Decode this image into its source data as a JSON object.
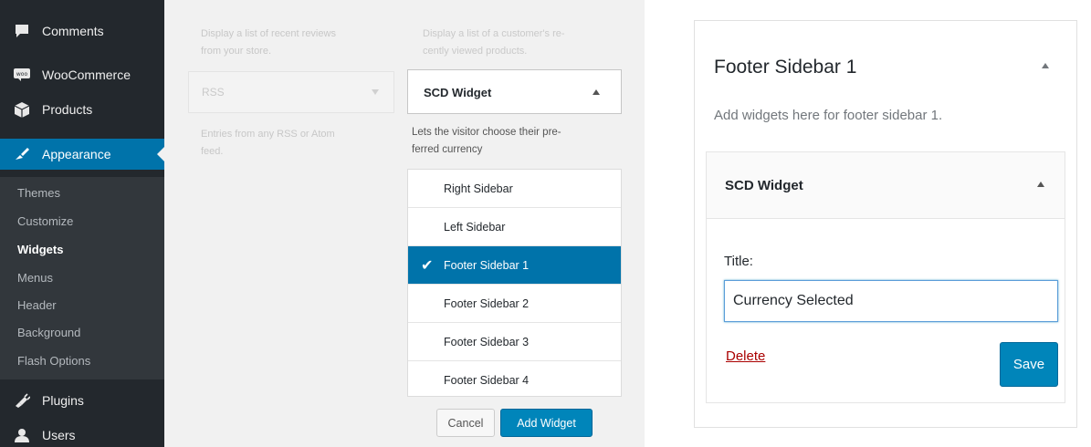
{
  "admin_menu": {
    "items": [
      {
        "label": "Comments",
        "icon": "comments-icon"
      },
      {
        "label": "WooCommerce",
        "icon": "woocommerce-icon"
      },
      {
        "label": "Products",
        "icon": "products-icon"
      },
      {
        "label": "Appearance",
        "icon": "appearance-icon",
        "active": true
      }
    ],
    "submenu": [
      "Themes",
      "Customize",
      "Widgets",
      "Menus",
      "Header",
      "Background",
      "Flash Options"
    ],
    "current_submenu": "Widgets",
    "lower_items": [
      {
        "label": "Plugins",
        "icon": "plugins-icon"
      },
      {
        "label": "Users",
        "icon": "users-icon"
      }
    ]
  },
  "available_widgets": {
    "recent_reviews_desc": [
      "Display a list of recent reviews",
      "from your store."
    ],
    "recently_viewed_desc": [
      "Display a list of a customer's re-",
      "cently viewed products."
    ],
    "rss_title": "RSS",
    "rss_desc": [
      "Entries from any RSS or Atom",
      "feed."
    ],
    "scd_widget_title": "SCD Widget",
    "scd_widget_desc": [
      "Lets the visitor choose their pre-",
      "ferred currency"
    ]
  },
  "sidebar_chooser": {
    "options": [
      "Right Sidebar",
      "Left Sidebar",
      "Footer Sidebar 1",
      "Footer Sidebar 2",
      "Footer Sidebar 3",
      "Footer Sidebar 4"
    ],
    "selected": "Footer Sidebar 1",
    "cancel_label": "Cancel",
    "add_label": "Add Widget"
  },
  "footer_sidebar": {
    "title": "Footer Sidebar 1",
    "description": "Add widgets here for footer sidebar 1.",
    "widget": {
      "title": "SCD Widget",
      "field_label": "Title:",
      "field_value": "Currency Selected",
      "delete_label": "Delete",
      "save_label": "Save"
    }
  },
  "colors": {
    "admin_bar": "#23282d",
    "accent": "#0073aa",
    "button_primary": "#0085ba",
    "delete_link": "#a00000"
  }
}
